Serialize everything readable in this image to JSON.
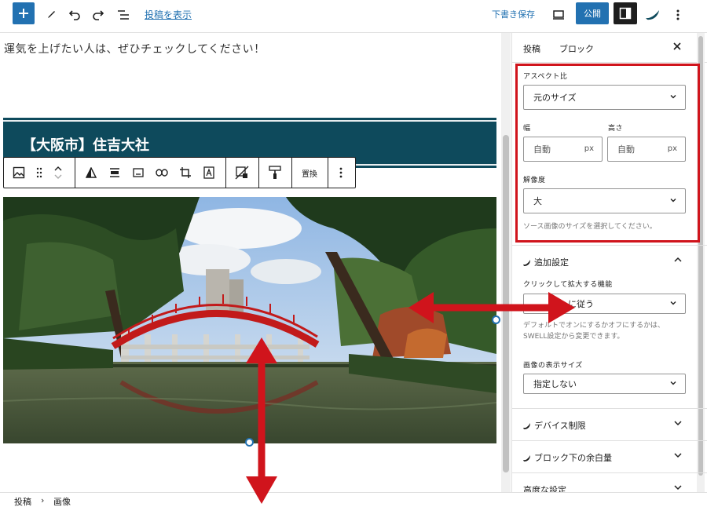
{
  "topbar": {
    "view_post": "投稿を表示",
    "save_draft": "下書き保存",
    "publish": "公開"
  },
  "editor": {
    "paragraph": "運気を上げたい人は、ぜひチェックしてください！",
    "heading": "【大阪市】住吉大社",
    "toolbar_replace": "置換"
  },
  "sidebar": {
    "tab_post": "投稿",
    "tab_block": "ブロック",
    "aspect_ratio_label": "アスペクト比",
    "aspect_ratio_value": "元のサイズ",
    "width_label": "幅",
    "height_label": "高さ",
    "width_placeholder": "自動",
    "height_placeholder": "自動",
    "unit": "px",
    "resolution_label": "解像度",
    "resolution_value": "大",
    "resolution_help": "ソース画像のサイズを選択してください。",
    "extra_settings": "追加設定",
    "lightbox_label": "クリックして拡大する機能",
    "lightbox_value": "に従う",
    "lightbox_help": "デフォルトでオンにするかオフにするかは、SWELL設定から変更できます。",
    "display_size_label": "画像の表示サイズ",
    "display_size_value": "指定しない",
    "device_limit": "デバイス制限",
    "margin_below": "ブロック下の余白量",
    "advanced": "高度な設定"
  },
  "breadcrumb": {
    "post": "投稿",
    "sep": "›",
    "image": "画像"
  },
  "colors": {
    "accent": "#2271b1",
    "heading_band": "#0e4a5c",
    "highlight": "#d0141c"
  }
}
